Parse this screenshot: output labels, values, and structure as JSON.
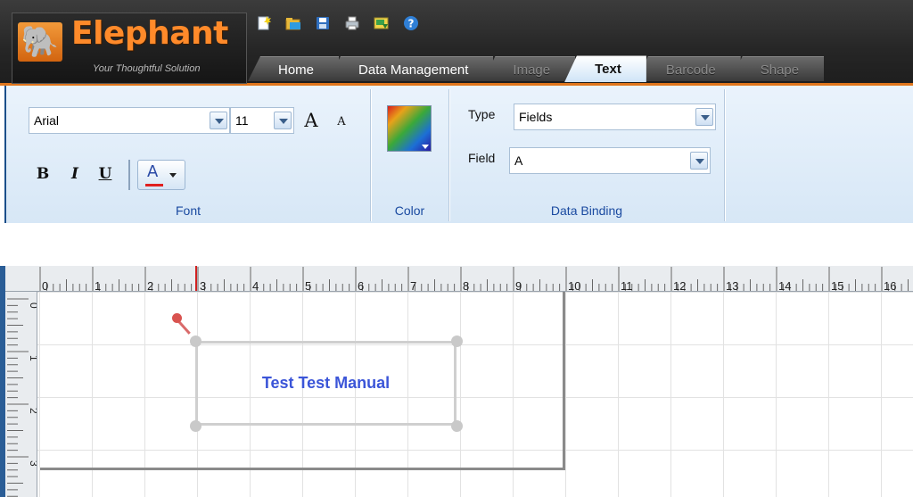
{
  "app": {
    "brand": "Elephant",
    "tagline": "Your Thoughtful Solution"
  },
  "quick_access": [
    {
      "name": "new-icon"
    },
    {
      "name": "open-icon"
    },
    {
      "name": "save-icon"
    },
    {
      "name": "print-icon"
    },
    {
      "name": "export-icon"
    },
    {
      "name": "help-icon"
    }
  ],
  "tabs": [
    {
      "label": "Home",
      "state": "normal"
    },
    {
      "label": "Data Management",
      "state": "normal"
    },
    {
      "label": "Image",
      "state": "disabled"
    },
    {
      "label": "Text",
      "state": "active"
    },
    {
      "label": "Barcode",
      "state": "disabled"
    },
    {
      "label": "Shape",
      "state": "disabled"
    }
  ],
  "ribbon": {
    "font": {
      "family": "Arial",
      "size": "11",
      "grow_label": "A",
      "shrink_label": "A",
      "bold_label": "B",
      "italic_label": "I",
      "underline_label": "U",
      "color_label": "A",
      "group_label": "Font"
    },
    "color": {
      "group_label": "Color"
    },
    "data_binding": {
      "type_label": "Type",
      "type_value": "Fields",
      "field_label": "Field",
      "field_value": "A",
      "group_label": "Data Binding"
    }
  },
  "ruler": {
    "top_labels": [
      "0",
      "1",
      "2",
      "3",
      "4",
      "5",
      "6",
      "7",
      "8",
      "9",
      "10",
      "11",
      "12",
      "13",
      "14",
      "15",
      "16"
    ],
    "left_labels": [
      "0",
      "1",
      "2",
      "3"
    ]
  },
  "canvas": {
    "text_object": "Test Test Manual"
  },
  "colors": {
    "accent_orange": "#e0761c",
    "ribbon_label_blue": "#1a4aa0",
    "text_object_blue": "#3b55d8"
  }
}
